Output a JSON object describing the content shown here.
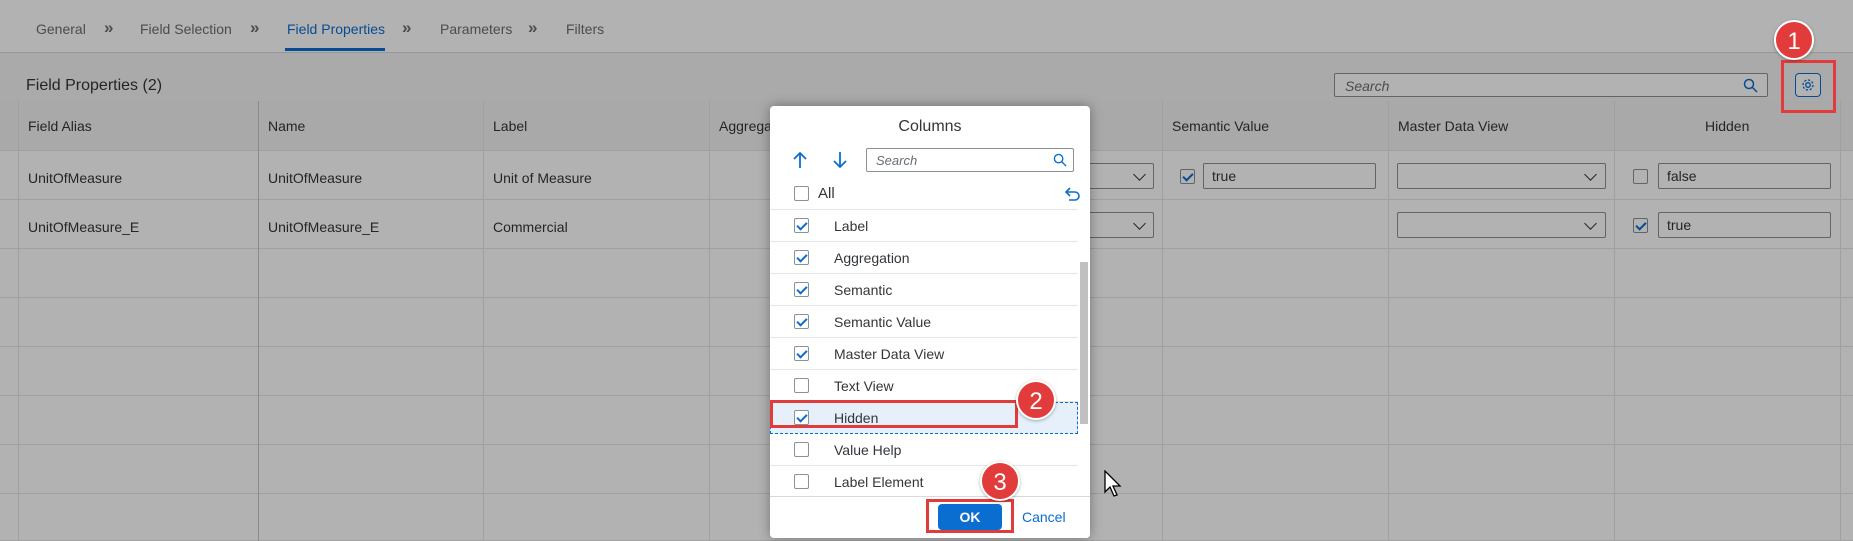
{
  "wizard": {
    "steps": [
      "General",
      "Field Selection",
      "Field Properties",
      "Parameters",
      "Filters"
    ],
    "separator": "»"
  },
  "toolbar": {
    "title": "Field Properties (2)",
    "search_placeholder": "Search"
  },
  "table": {
    "headers": {
      "field_alias": "Field Alias",
      "name": "Name",
      "label": "Label",
      "aggregation": "Aggrega",
      "semantic_value": "Semantic Value",
      "master_data_view": "Master Data View",
      "hidden": "Hidden"
    },
    "rows": [
      {
        "field_alias": "UnitOfMeasure",
        "name": "UnitOfMeasure",
        "label": "Unit of Measure",
        "semantic_value_checked": true,
        "semantic_value": "true",
        "hidden_checked": false,
        "hidden": "false"
      },
      {
        "field_alias": "UnitOfMeasure_E",
        "name": "UnitOfMeasure_E",
        "label": "Commercial",
        "semantic_value_checked": false,
        "semantic_value": "",
        "hidden_checked": true,
        "hidden": "true"
      }
    ]
  },
  "dialog": {
    "title": "Columns",
    "search_placeholder": "Search",
    "all_label": "All",
    "items": [
      {
        "label": "Label",
        "checked": true
      },
      {
        "label": "Aggregation",
        "checked": true
      },
      {
        "label": "Semantic",
        "checked": true
      },
      {
        "label": "Semantic Value",
        "checked": true
      },
      {
        "label": "Master Data View",
        "checked": true
      },
      {
        "label": "Text View",
        "checked": false
      },
      {
        "label": "Hidden",
        "checked": true,
        "selected": true
      },
      {
        "label": "Value Help",
        "checked": false
      },
      {
        "label": "Label Element",
        "checked": false
      }
    ],
    "ok_label": "OK",
    "cancel_label": "Cancel"
  },
  "annotations": {
    "badge_1": "1",
    "badge_2": "2",
    "badge_3": "3",
    "color": "#e23b3b"
  },
  "colors": {
    "accent": "#0a6ed1"
  }
}
